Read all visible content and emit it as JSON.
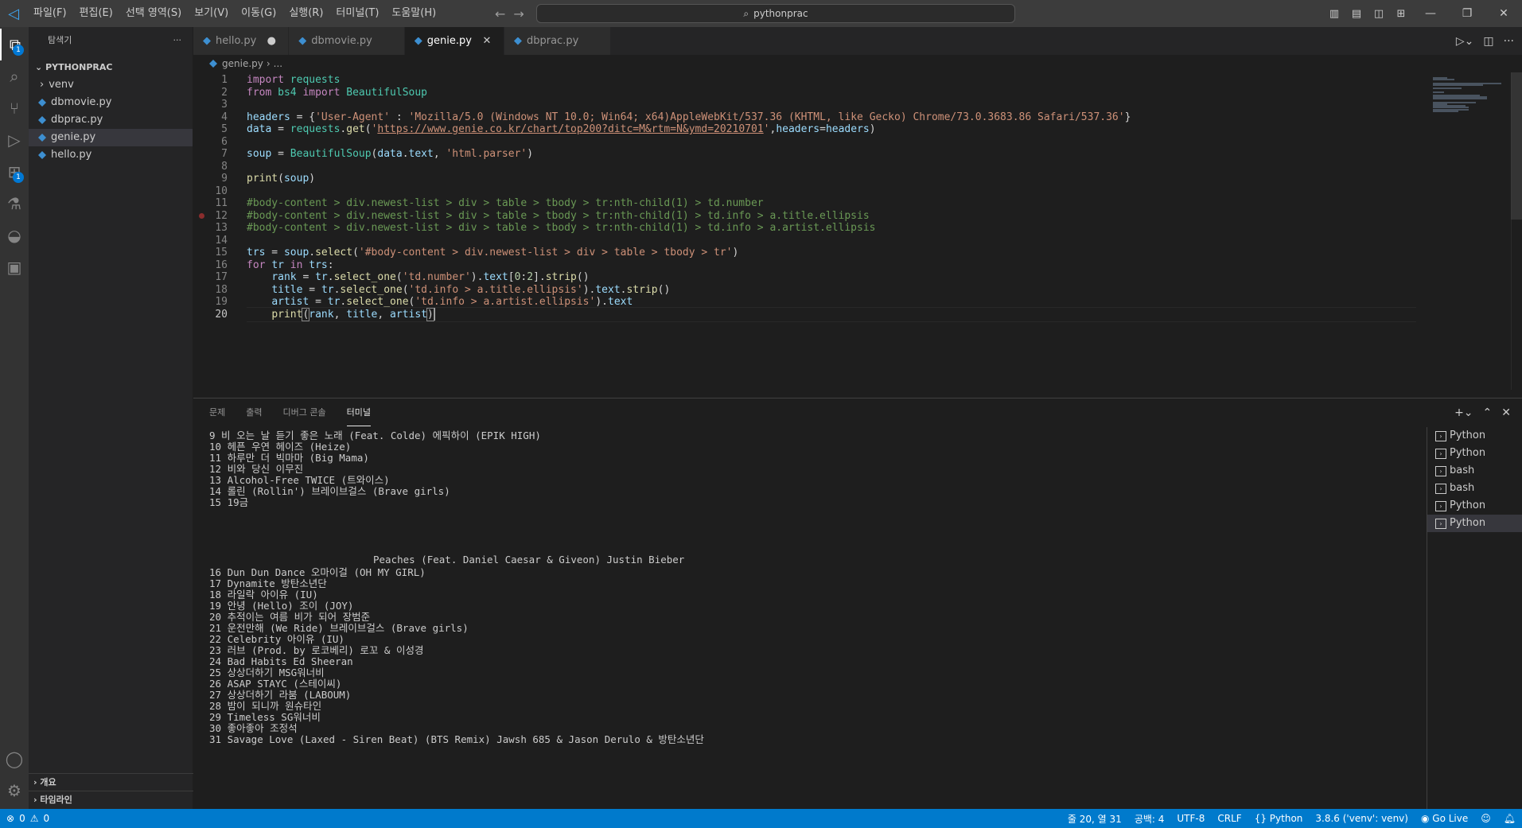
{
  "titlebar": {
    "menu": [
      "파일(F)",
      "편집(E)",
      "선택 영역(S)",
      "보기(V)",
      "이동(G)",
      "실행(R)",
      "터미널(T)",
      "도움말(H)"
    ],
    "search": "pythonprac"
  },
  "activity_badges": {
    "explorer": "1",
    "extensions": "1"
  },
  "sidebar": {
    "title": "탐색기",
    "folder": "PYTHONPRAC",
    "items": [
      {
        "label": "venv",
        "type": "folder"
      },
      {
        "label": "dbmovie.py",
        "type": "python"
      },
      {
        "label": "dbprac.py",
        "type": "python"
      },
      {
        "label": "genie.py",
        "type": "python"
      },
      {
        "label": "hello.py",
        "type": "python"
      }
    ],
    "outline": "개요",
    "timeline": "타임라인"
  },
  "tabs": [
    {
      "label": "hello.py",
      "state": "modified"
    },
    {
      "label": "dbmovie.py",
      "state": ""
    },
    {
      "label": "genie.py",
      "state": "active"
    },
    {
      "label": "dbprac.py",
      "state": ""
    }
  ],
  "breadcrumb": {
    "file": "genie.py",
    "rest": "..."
  },
  "editor": {
    "lines": [
      {
        "n": "1",
        "html": "<span style='color:#c586c0'>import</span> <span style='color:#4ec9b0'>requests</span>"
      },
      {
        "n": "2",
        "html": "<span style='color:#c586c0'>from</span> <span style='color:#4ec9b0'>bs4</span> <span style='color:#c586c0'>import</span> <span style='color:#4ec9b0'>BeautifulSoup</span>"
      },
      {
        "n": "3",
        "html": ""
      },
      {
        "n": "4",
        "html": "<span style='color:#9cdcfe'>headers</span> = {<span style='color:#ce9178'>'User-Agent'</span> : <span style='color:#ce9178'>'Mozilla/5.0 (Windows NT 10.0; Win64; x64)AppleWebKit/537.36 (KHTML, like Gecko) Chrome/73.0.3683.86 Safari/537.36'</span>}"
      },
      {
        "n": "5",
        "html": "<span style='color:#9cdcfe'>data</span> = <span style='color:#4ec9b0'>requests</span>.<span style='color:#dcdcaa'>get</span>(<span style='color:#ce9178'>'<u>https://www.genie.co.kr/chart/top200?ditc=M&amp;rtm=N&amp;ymd=20210701</u>'</span>,<span style='color:#9cdcfe'>headers</span>=<span style='color:#9cdcfe'>headers</span>)"
      },
      {
        "n": "6",
        "html": ""
      },
      {
        "n": "7",
        "html": "<span style='color:#9cdcfe'>soup</span> = <span style='color:#4ec9b0'>BeautifulSoup</span>(<span style='color:#9cdcfe'>data</span>.<span style='color:#9cdcfe'>text</span>, <span style='color:#ce9178'>'html.parser'</span>)"
      },
      {
        "n": "8",
        "html": ""
      },
      {
        "n": "9",
        "html": "<span style='color:#dcdcaa'>print</span>(<span style='color:#9cdcfe'>soup</span>)"
      },
      {
        "n": "10",
        "html": ""
      },
      {
        "n": "11",
        "html": "<span style='color:#6a9955'>#body-content &gt; div.newest-list &gt; div &gt; table &gt; tbody &gt; tr:nth-child(1) &gt; td.number</span>"
      },
      {
        "n": "12",
        "html": "<span style='color:#6a9955'>#body-content &gt; div.newest-list &gt; div &gt; table &gt; tbody &gt; tr:nth-child(1) &gt; td.info &gt; a.title.ellipsis</span>"
      },
      {
        "n": "13",
        "html": "<span style='color:#6a9955'>#body-content &gt; div.newest-list &gt; div &gt; table &gt; tbody &gt; tr:nth-child(1) &gt; td.info &gt; a.artist.ellipsis</span>"
      },
      {
        "n": "14",
        "html": ""
      },
      {
        "n": "15",
        "html": "<span style='color:#9cdcfe'>trs</span> = <span style='color:#9cdcfe'>soup</span>.<span style='color:#dcdcaa'>select</span>(<span style='color:#ce9178'>'#body-content &gt; div.newest-list &gt; div &gt; table &gt; tbody &gt; tr'</span>)"
      },
      {
        "n": "16",
        "html": "<span style='color:#c586c0'>for</span> <span style='color:#9cdcfe'>tr</span> <span style='color:#c586c0'>in</span> <span style='color:#9cdcfe'>trs</span>:"
      },
      {
        "n": "17",
        "html": "    <span style='color:#9cdcfe'>rank</span> = <span style='color:#9cdcfe'>tr</span>.<span style='color:#dcdcaa'>select_one</span>(<span style='color:#ce9178'>'td.number'</span>).<span style='color:#9cdcfe'>text</span>[<span style='color:#b5cea8'>0</span>:<span style='color:#b5cea8'>2</span>].<span style='color:#dcdcaa'>strip</span>()"
      },
      {
        "n": "18",
        "html": "    <span style='color:#9cdcfe'>title</span> = <span style='color:#9cdcfe'>tr</span>.<span style='color:#dcdcaa'>select_one</span>(<span style='color:#ce9178'>'td.info &gt; a.title.ellipsis'</span>).<span style='color:#9cdcfe'>text</span>.<span style='color:#dcdcaa'>strip</span>()"
      },
      {
        "n": "19",
        "html": "    <span style='color:#9cdcfe'>artist</span> = <span style='color:#9cdcfe'>tr</span>.<span style='color:#dcdcaa'>select_one</span>(<span style='color:#ce9178'>'td.info &gt; a.artist.ellipsis'</span>).<span style='color:#9cdcfe'>text</span>"
      },
      {
        "n": "20",
        "html": "    <span style='color:#dcdcaa'>print</span><span style='outline:1px solid #888'>(</span><span style='color:#9cdcfe'>rank</span>, <span style='color:#9cdcfe'>title</span>, <span style='color:#9cdcfe'>artist</span><span style='outline:1px solid #888'>)</span><span class='cursor'></span>"
      }
    ]
  },
  "panel": {
    "tabs": [
      "문제",
      "출력",
      "디버그 콘솔",
      "터미널"
    ],
    "active_tab": "터미널",
    "terminal_lines": [
      "9 비 오는 날 듣기 좋은 노래 (Feat. Colde) 에픽하이 (EPIK HIGH)",
      "10 헤픈 우연 헤이즈 (Heize)",
      "11 하루만 더 빅마마 (Big Mama)",
      "12 비와 당신 이무진",
      "13 Alcohol-Free TWICE (트와이스)",
      "14 롤린 (Rollin') 브레이브걸스 (Brave girls)",
      "15 19금",
      "Peaches (Feat. Daniel Caesar & Giveon) Justin Bieber",
      "16 Dun Dun Dance 오마이걸 (OH MY GIRL)",
      "17 Dynamite 방탄소년단",
      "18 라일락 아이유 (IU)",
      "19 안녕 (Hello) 조이 (JOY)",
      "20 추적이는 여름 비가 되어 장범준",
      "21 운전만해 (We Ride) 브레이브걸스 (Brave girls)",
      "22 Celebrity 아이유 (IU)",
      "23 러브 (Prod. by 로코베리) 로꼬 & 이성경",
      "24 Bad Habits Ed Sheeran",
      "25 상상더하기 MSG워너비",
      "26 ASAP STAYC (스테이씨)",
      "27 상상더하기 라붐 (LABOUM)",
      "28 밤이 되니까 원슈타인",
      "29 Timeless SG워너비",
      "30 좋아좋아 조정석",
      "31 Savage Love (Laxed - Siren Beat) (BTS Remix) Jawsh 685 & Jason Derulo & 방탄소년단"
    ],
    "terminals": [
      {
        "label": "Python",
        "active": false
      },
      {
        "label": "Python",
        "active": false
      },
      {
        "label": "bash",
        "active": false
      },
      {
        "label": "bash",
        "active": false
      },
      {
        "label": "Python",
        "active": false
      },
      {
        "label": "Python",
        "active": true
      }
    ]
  },
  "statusbar": {
    "errors": "0",
    "warnings": "0",
    "position": "줄 20, 열 31",
    "spaces": "공백: 4",
    "encoding": "UTF-8",
    "eol": "CRLF",
    "language": "Python",
    "interpreter": "3.8.6 ('venv': venv)",
    "golive": "Go Live"
  }
}
